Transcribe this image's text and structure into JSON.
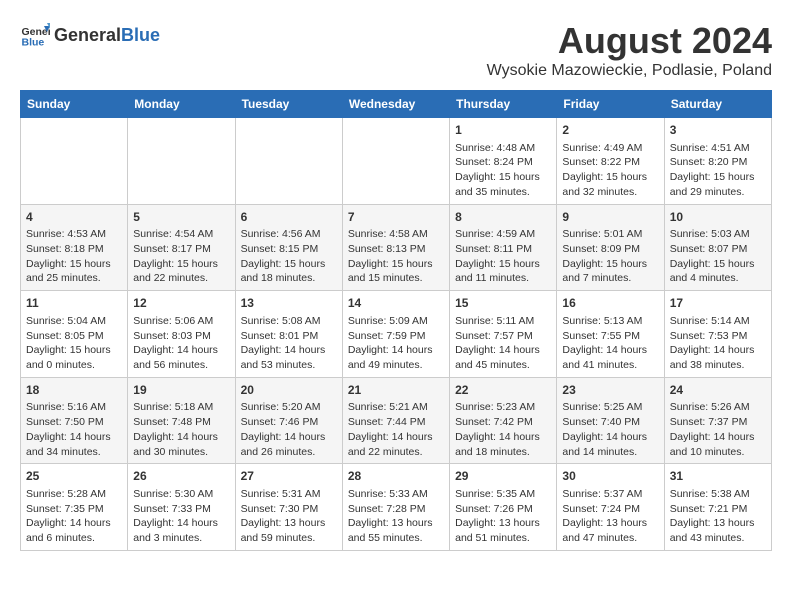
{
  "header": {
    "logo_general": "General",
    "logo_blue": "Blue",
    "title": "August 2024",
    "subtitle": "Wysokie Mazowieckie, Podlasie, Poland"
  },
  "calendar": {
    "days_of_week": [
      "Sunday",
      "Monday",
      "Tuesday",
      "Wednesday",
      "Thursday",
      "Friday",
      "Saturday"
    ],
    "weeks": [
      [
        {
          "day": "",
          "info": ""
        },
        {
          "day": "",
          "info": ""
        },
        {
          "day": "",
          "info": ""
        },
        {
          "day": "",
          "info": ""
        },
        {
          "day": "1",
          "info": "Sunrise: 4:48 AM\nSunset: 8:24 PM\nDaylight: 15 hours\nand 35 minutes."
        },
        {
          "day": "2",
          "info": "Sunrise: 4:49 AM\nSunset: 8:22 PM\nDaylight: 15 hours\nand 32 minutes."
        },
        {
          "day": "3",
          "info": "Sunrise: 4:51 AM\nSunset: 8:20 PM\nDaylight: 15 hours\nand 29 minutes."
        }
      ],
      [
        {
          "day": "4",
          "info": "Sunrise: 4:53 AM\nSunset: 8:18 PM\nDaylight: 15 hours\nand 25 minutes."
        },
        {
          "day": "5",
          "info": "Sunrise: 4:54 AM\nSunset: 8:17 PM\nDaylight: 15 hours\nand 22 minutes."
        },
        {
          "day": "6",
          "info": "Sunrise: 4:56 AM\nSunset: 8:15 PM\nDaylight: 15 hours\nand 18 minutes."
        },
        {
          "day": "7",
          "info": "Sunrise: 4:58 AM\nSunset: 8:13 PM\nDaylight: 15 hours\nand 15 minutes."
        },
        {
          "day": "8",
          "info": "Sunrise: 4:59 AM\nSunset: 8:11 PM\nDaylight: 15 hours\nand 11 minutes."
        },
        {
          "day": "9",
          "info": "Sunrise: 5:01 AM\nSunset: 8:09 PM\nDaylight: 15 hours\nand 7 minutes."
        },
        {
          "day": "10",
          "info": "Sunrise: 5:03 AM\nSunset: 8:07 PM\nDaylight: 15 hours\nand 4 minutes."
        }
      ],
      [
        {
          "day": "11",
          "info": "Sunrise: 5:04 AM\nSunset: 8:05 PM\nDaylight: 15 hours\nand 0 minutes."
        },
        {
          "day": "12",
          "info": "Sunrise: 5:06 AM\nSunset: 8:03 PM\nDaylight: 14 hours\nand 56 minutes."
        },
        {
          "day": "13",
          "info": "Sunrise: 5:08 AM\nSunset: 8:01 PM\nDaylight: 14 hours\nand 53 minutes."
        },
        {
          "day": "14",
          "info": "Sunrise: 5:09 AM\nSunset: 7:59 PM\nDaylight: 14 hours\nand 49 minutes."
        },
        {
          "day": "15",
          "info": "Sunrise: 5:11 AM\nSunset: 7:57 PM\nDaylight: 14 hours\nand 45 minutes."
        },
        {
          "day": "16",
          "info": "Sunrise: 5:13 AM\nSunset: 7:55 PM\nDaylight: 14 hours\nand 41 minutes."
        },
        {
          "day": "17",
          "info": "Sunrise: 5:14 AM\nSunset: 7:53 PM\nDaylight: 14 hours\nand 38 minutes."
        }
      ],
      [
        {
          "day": "18",
          "info": "Sunrise: 5:16 AM\nSunset: 7:50 PM\nDaylight: 14 hours\nand 34 minutes."
        },
        {
          "day": "19",
          "info": "Sunrise: 5:18 AM\nSunset: 7:48 PM\nDaylight: 14 hours\nand 30 minutes."
        },
        {
          "day": "20",
          "info": "Sunrise: 5:20 AM\nSunset: 7:46 PM\nDaylight: 14 hours\nand 26 minutes."
        },
        {
          "day": "21",
          "info": "Sunrise: 5:21 AM\nSunset: 7:44 PM\nDaylight: 14 hours\nand 22 minutes."
        },
        {
          "day": "22",
          "info": "Sunrise: 5:23 AM\nSunset: 7:42 PM\nDaylight: 14 hours\nand 18 minutes."
        },
        {
          "day": "23",
          "info": "Sunrise: 5:25 AM\nSunset: 7:40 PM\nDaylight: 14 hours\nand 14 minutes."
        },
        {
          "day": "24",
          "info": "Sunrise: 5:26 AM\nSunset: 7:37 PM\nDaylight: 14 hours\nand 10 minutes."
        }
      ],
      [
        {
          "day": "25",
          "info": "Sunrise: 5:28 AM\nSunset: 7:35 PM\nDaylight: 14 hours\nand 6 minutes."
        },
        {
          "day": "26",
          "info": "Sunrise: 5:30 AM\nSunset: 7:33 PM\nDaylight: 14 hours\nand 3 minutes."
        },
        {
          "day": "27",
          "info": "Sunrise: 5:31 AM\nSunset: 7:30 PM\nDaylight: 13 hours\nand 59 minutes."
        },
        {
          "day": "28",
          "info": "Sunrise: 5:33 AM\nSunset: 7:28 PM\nDaylight: 13 hours\nand 55 minutes."
        },
        {
          "day": "29",
          "info": "Sunrise: 5:35 AM\nSunset: 7:26 PM\nDaylight: 13 hours\nand 51 minutes."
        },
        {
          "day": "30",
          "info": "Sunrise: 5:37 AM\nSunset: 7:24 PM\nDaylight: 13 hours\nand 47 minutes."
        },
        {
          "day": "31",
          "info": "Sunrise: 5:38 AM\nSunset: 7:21 PM\nDaylight: 13 hours\nand 43 minutes."
        }
      ]
    ]
  }
}
